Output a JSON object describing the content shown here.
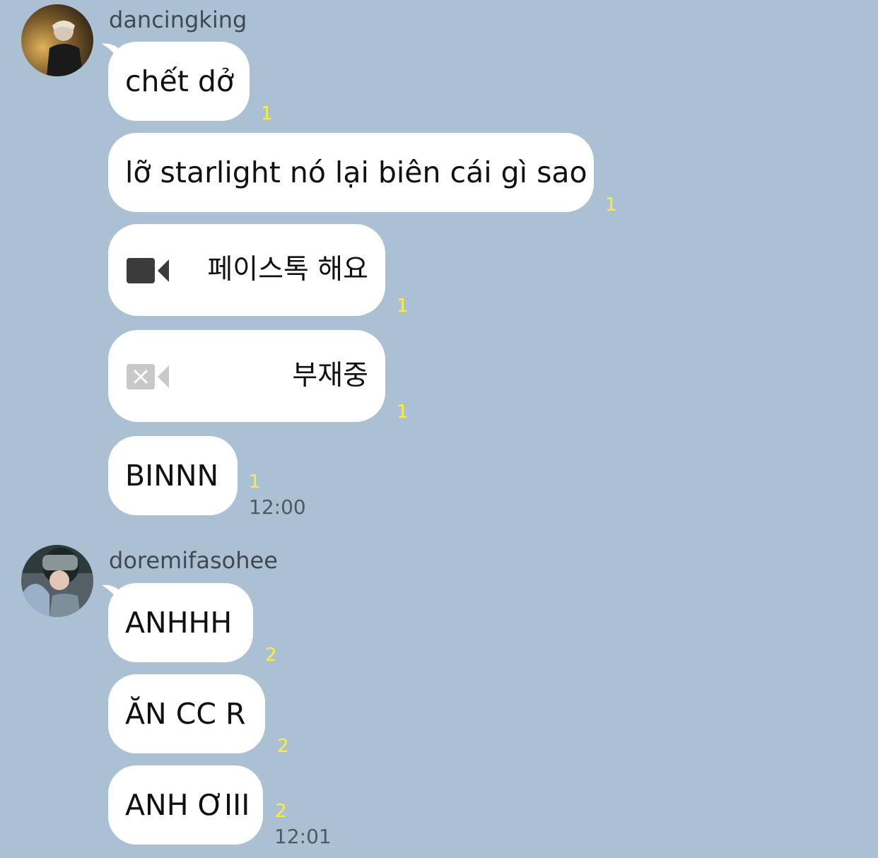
{
  "groups": [
    {
      "sender": "dancingking",
      "avatar_icon": "user-avatar-icon",
      "messages": [
        {
          "text": "chết dở",
          "unread": "1"
        },
        {
          "text": "lỡ starlight nó lại biên cái gì sao",
          "unread": "1"
        },
        {
          "type": "call",
          "icon": "video-call-icon",
          "text": "페이스톡 해요",
          "unread": "1"
        },
        {
          "type": "call",
          "icon": "missed-video-call-icon",
          "text": "부재중",
          "unread": "1"
        },
        {
          "text": "BINNN",
          "unread": "1",
          "time": "12:00"
        }
      ]
    },
    {
      "sender": "doremifasohee",
      "avatar_icon": "user-avatar-icon",
      "messages": [
        {
          "text": "ANHHH",
          "unread": "2"
        },
        {
          "text": "ĂN CC R",
          "unread": "2"
        },
        {
          "text": "ANH ƠIII",
          "unread": "2",
          "time": "12:01"
        }
      ]
    }
  ],
  "colors": {
    "background": "#abc1d3",
    "bubble": "#ffffff",
    "unread": "#ffee33",
    "time": "#4d5965"
  }
}
